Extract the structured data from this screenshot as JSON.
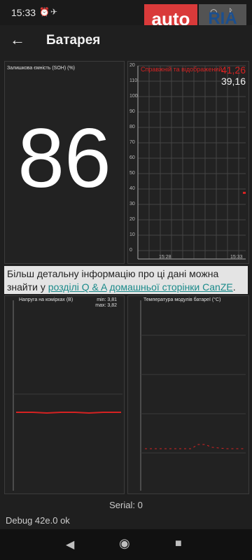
{
  "status": {
    "time": "15:33"
  },
  "watermark": {
    "part1": "auto",
    "part2": "RIA"
  },
  "appbar": {
    "title": "Батарея"
  },
  "soh": {
    "label": "Залишкова ємність (SOH) (%)",
    "value": "86"
  },
  "range_chart": {
    "label": "Справжній та відображений...",
    "value_top": "41,26",
    "value_bottom": "39,16",
    "y_ticks": [
      "20",
      "110",
      "100",
      "90",
      "80",
      "70",
      "60",
      "50",
      "40",
      "30",
      "20",
      "10",
      "0"
    ],
    "x_ticks": [
      "15:28",
      "15:33"
    ]
  },
  "info": {
    "text_pre": "Більш детальну інформацію про ці дані можна знайти у ",
    "link1": "розділі Q & A",
    "text_mid": " ",
    "link2": "домашньої сторінки CanZE",
    "text_post": "."
  },
  "cell_chart": {
    "label": "Напруга на комірках (В)",
    "min": "min: 3,81",
    "max": "max: 3,82"
  },
  "temp_chart": {
    "label": "Температура модулів батареї (°C)"
  },
  "footer": {
    "serial": "Serial: 0",
    "debug": "Debug 42e.0 ok"
  },
  "colors": {
    "accent": "#d62222",
    "background": "#1f1f1f"
  }
}
